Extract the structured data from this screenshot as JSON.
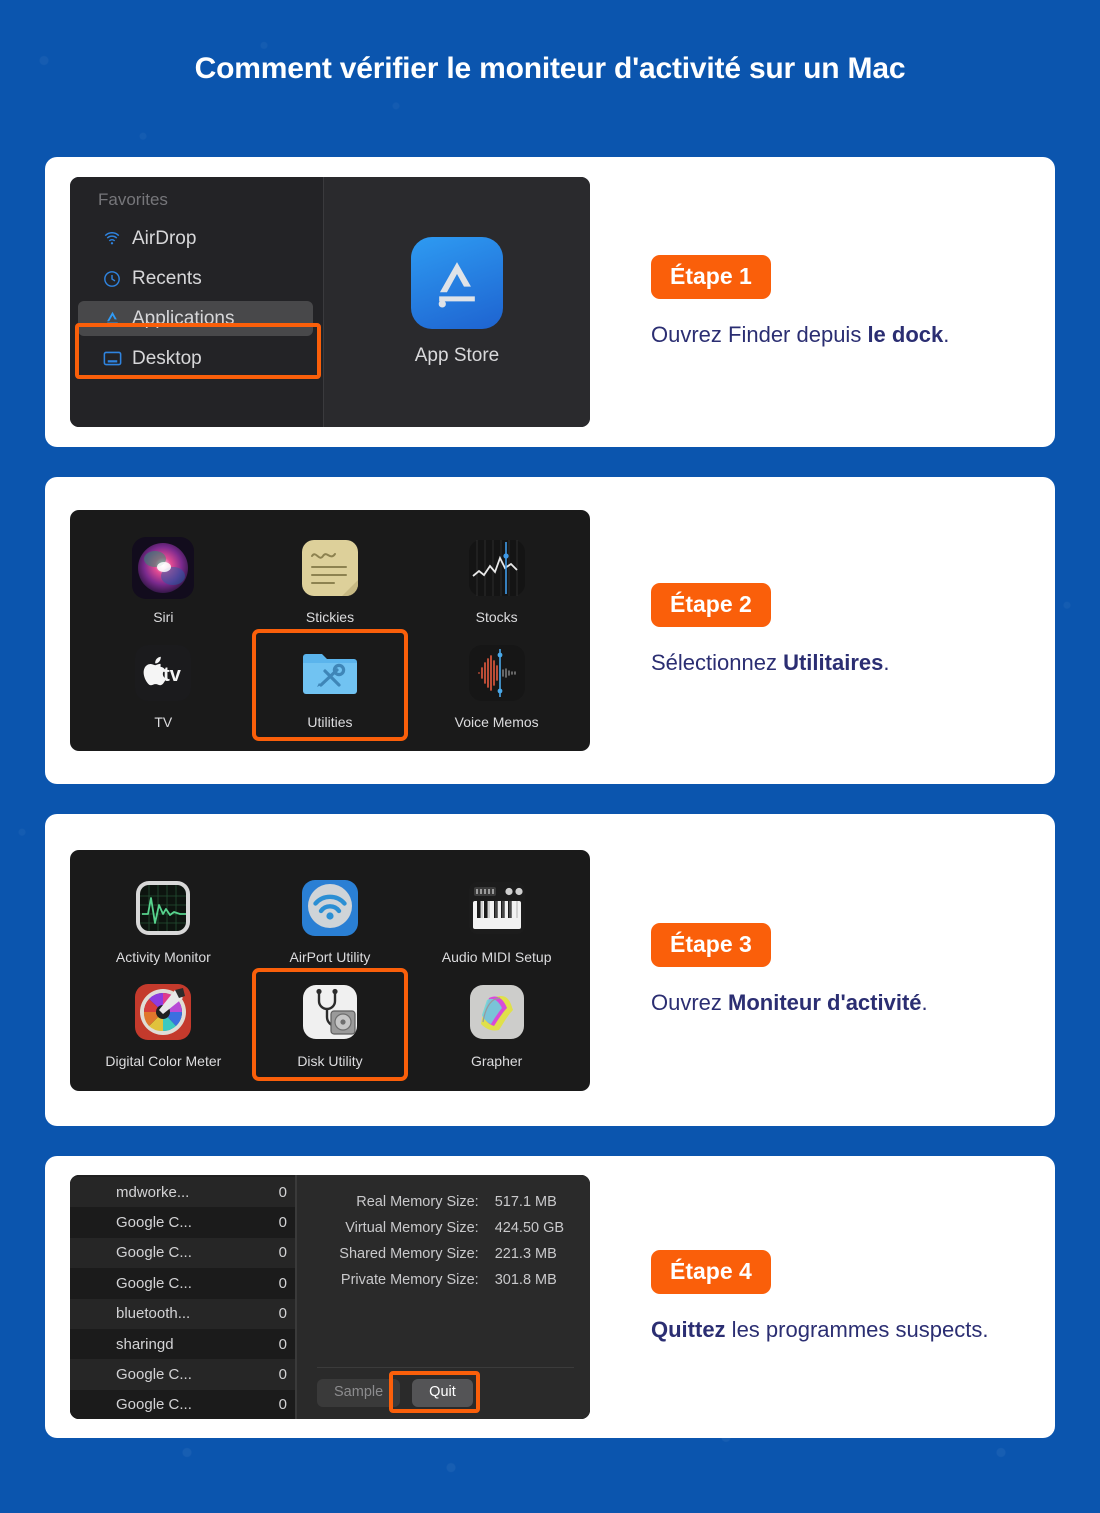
{
  "page": {
    "title": "Comment vérifier le moniteur d'activité sur un Mac",
    "background_color": "#0b55ae",
    "accent_orange": "#fa5f0a",
    "text_navy": "#2b2e72"
  },
  "steps": [
    {
      "badge": "Étape 1",
      "text_before": "Ouvrez Finder depuis ",
      "text_bold": "le dock",
      "text_after": "."
    },
    {
      "badge": "Étape 2",
      "text_before": "Sélectionnez ",
      "text_bold": "Utilitaires",
      "text_after": "."
    },
    {
      "badge": "Étape 3",
      "text_before": "Ouvrez ",
      "text_bold": "Moniteur d'activité",
      "text_after": "."
    },
    {
      "badge": "Étape 4",
      "text_before": "",
      "text_bold": "Quittez",
      "text_after": " les programmes suspects."
    }
  ],
  "finder": {
    "section_label": "Favorites",
    "items": [
      {
        "label": "AirDrop",
        "icon": "airdrop-icon",
        "selected": false
      },
      {
        "label": "Recents",
        "icon": "clock-icon",
        "selected": false
      },
      {
        "label": "Applications",
        "icon": "app-store-icon",
        "selected": true
      },
      {
        "label": "Desktop",
        "icon": "desktop-icon",
        "selected": false
      }
    ],
    "content_app": {
      "label": "App Store",
      "icon": "app-store-icon"
    }
  },
  "applications_grid": {
    "items": [
      {
        "label": "Siri",
        "icon": "siri-icon",
        "selected": false
      },
      {
        "label": "Stickies",
        "icon": "stickies-icon",
        "selected": false
      },
      {
        "label": "Stocks",
        "icon": "stocks-icon",
        "selected": false
      },
      {
        "label": "TV",
        "icon": "apple-tv-icon",
        "selected": false
      },
      {
        "label": "Utilities",
        "icon": "utilities-folder-icon",
        "selected": true
      },
      {
        "label": "Voice Memos",
        "icon": "voice-memos-icon",
        "selected": false
      }
    ]
  },
  "utilities_grid": {
    "items": [
      {
        "label": "Activity Monitor",
        "icon": "activity-monitor-icon",
        "selected": false
      },
      {
        "label": "AirPort Utility",
        "icon": "airport-utility-icon",
        "selected": false
      },
      {
        "label": "Audio MIDI Setup",
        "icon": "audio-midi-setup-icon",
        "selected": false
      },
      {
        "label": "Digital Color Meter",
        "icon": "digital-color-meter-icon",
        "selected": false
      },
      {
        "label": "Disk Utility",
        "icon": "disk-utility-icon",
        "selected": true
      },
      {
        "label": "Grapher",
        "icon": "grapher-icon",
        "selected": false
      }
    ]
  },
  "activity_monitor": {
    "processes": [
      {
        "name": "mdworke...",
        "value": "0"
      },
      {
        "name": "Google C...",
        "value": "0"
      },
      {
        "name": "Google C...",
        "value": "0"
      },
      {
        "name": "Google C...",
        "value": "0"
      },
      {
        "name": "bluetooth...",
        "value": "0"
      },
      {
        "name": "sharingd",
        "value": "0"
      },
      {
        "name": "Google C...",
        "value": "0"
      },
      {
        "name": "Google C...",
        "value": "0"
      }
    ],
    "memory_details": [
      {
        "label": "Real Memory Size:",
        "value": "517.1 MB"
      },
      {
        "label": "Virtual Memory Size:",
        "value": "424.50 GB"
      },
      {
        "label": "Shared Memory Size:",
        "value": "221.3 MB"
      },
      {
        "label": "Private Memory Size:",
        "value": "301.8 MB"
      }
    ],
    "buttons": {
      "sample": "Sample",
      "quit": "Quit"
    }
  }
}
